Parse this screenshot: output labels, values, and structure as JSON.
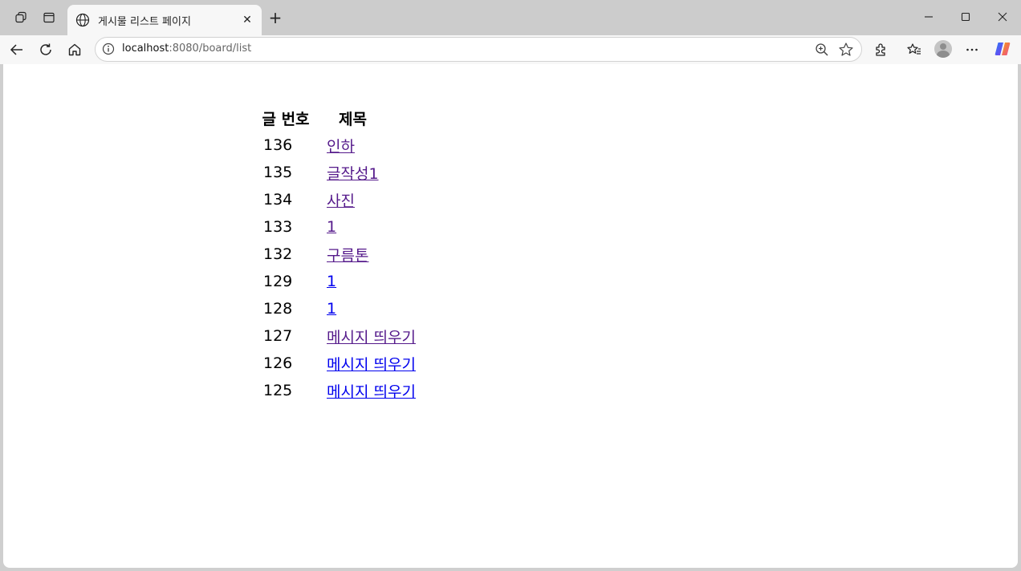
{
  "browser": {
    "tab_title": "게시물 리스트 페이지",
    "url_host": "localhost",
    "url_path": ":8080/board/list"
  },
  "table": {
    "headers": [
      "글 번호",
      "제목"
    ],
    "rows": [
      {
        "num": "136",
        "title": "인하",
        "visited": true
      },
      {
        "num": "135",
        "title": "글작성1",
        "visited": true
      },
      {
        "num": "134",
        "title": "사진",
        "visited": true
      },
      {
        "num": "133",
        "title": "1",
        "visited": true
      },
      {
        "num": "132",
        "title": "구름톤",
        "visited": true
      },
      {
        "num": "129",
        "title": "1",
        "visited": false
      },
      {
        "num": "128",
        "title": "1",
        "visited": false
      },
      {
        "num": "127",
        "title": "메시지 띄우기",
        "visited": true
      },
      {
        "num": "126",
        "title": "메시지 띄우기",
        "visited": false
      },
      {
        "num": "125",
        "title": "메시지 띄우기",
        "visited": false
      }
    ]
  },
  "colors": {
    "visited_link": "#551a8b",
    "unvisited_link": "#0000ee"
  }
}
